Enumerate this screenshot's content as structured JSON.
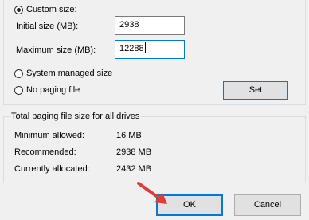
{
  "paging": {
    "custom_size_label": "Custom size:",
    "initial_size_label": "Initial size (MB):",
    "initial_size_value": "2938",
    "maximum_size_label": "Maximum size (MB):",
    "maximum_size_value": "12288",
    "system_managed_label": "System managed size",
    "no_paging_label": "No paging file",
    "set_button": "Set",
    "selected_option": "custom_size"
  },
  "totals": {
    "title": "Total paging file size for all drives",
    "rows": [
      {
        "label": "Minimum allowed:",
        "value": "16 MB"
      },
      {
        "label": "Recommended:",
        "value": "2938 MB"
      },
      {
        "label": "Currently allocated:",
        "value": "2432 MB"
      }
    ]
  },
  "dialog": {
    "ok_button": "OK",
    "cancel_button": "Cancel"
  },
  "colors": {
    "focus_border": "#0078d7",
    "arrow": "#e03b3b"
  }
}
